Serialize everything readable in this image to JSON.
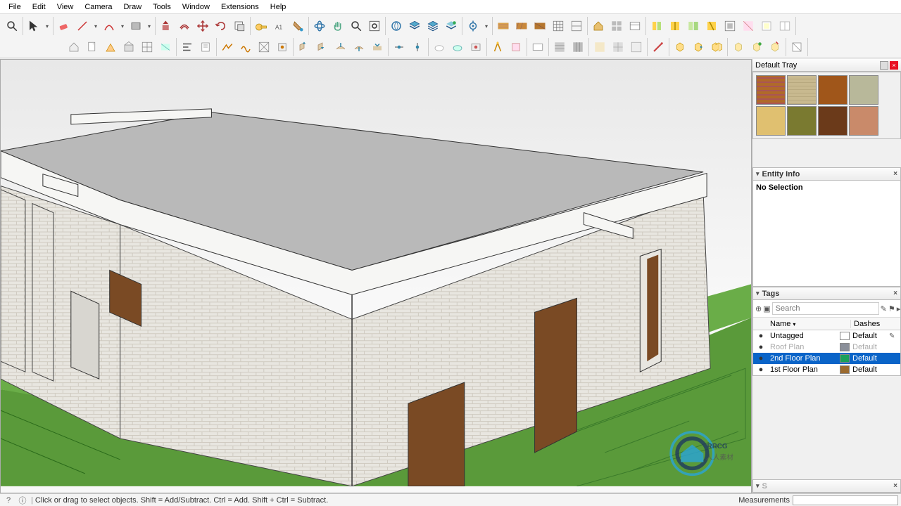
{
  "menu": [
    "File",
    "Edit",
    "View",
    "Camera",
    "Draw",
    "Tools",
    "Window",
    "Extensions",
    "Help"
  ],
  "tray": {
    "title": "Default Tray"
  },
  "entity": {
    "title": "Entity Info",
    "message": "No Selection"
  },
  "tags": {
    "title": "Tags",
    "search_placeholder": "Search",
    "cols": {
      "name": "Name",
      "dashes": "Dashes"
    },
    "rows": [
      {
        "vis": "●",
        "name": "Untagged",
        "dash": "Default",
        "color": "#ffffff",
        "dim": false,
        "pen": true
      },
      {
        "vis": "●",
        "name": "Roof Plan",
        "dash": "Default",
        "color": "#8a8f99",
        "dim": true,
        "pen": false
      },
      {
        "vis": "●",
        "name": "2nd Floor Plan",
        "dash": "Default",
        "color": "#1aa05a",
        "dim": false,
        "pen": false,
        "sel": true
      },
      {
        "vis": "●",
        "name": "1st Floor Plan",
        "dash": "Default",
        "color": "#9b6a2f",
        "dim": false,
        "pen": false
      }
    ]
  },
  "materials": {
    "colors": [
      "#b06a2a",
      "#c8b98f",
      "#a0561a",
      "#b8b89a",
      "#e0c070",
      "#7a7a30",
      "#6b3a1a",
      "#c98a6a"
    ]
  },
  "status": {
    "hint": "Click or drag to select objects. Shift = Add/Subtract. Ctrl = Add. Shift + Ctrl = Subtract.",
    "meas_label": "Measurements"
  },
  "watermark": "RRCG"
}
